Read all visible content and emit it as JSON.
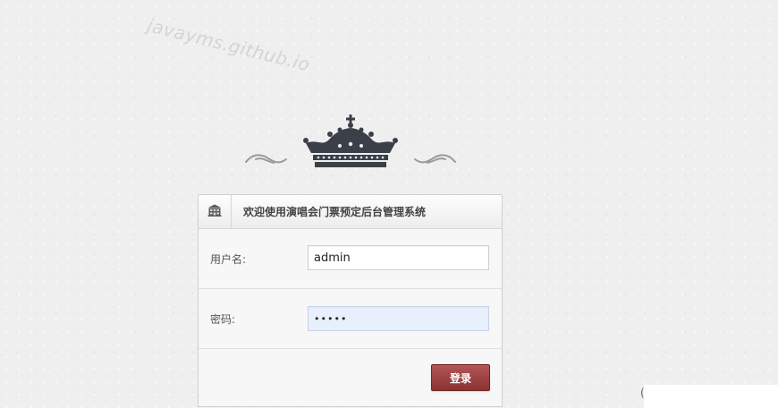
{
  "watermark": {
    "text": "javayms.github.io"
  },
  "decorations": {
    "crown_icon": "crown-icon",
    "left_flourish_icon": "flourish-left-icon",
    "right_flourish_icon": "flourish-right-icon",
    "crown_color": "#3b3f48",
    "flourish_color": "#9a9a9a"
  },
  "login_panel": {
    "header_icon": "building-icon",
    "title": "欢迎使用演唱会门票预定后台管理系统",
    "username": {
      "label": "用户名:",
      "value": "admin"
    },
    "password": {
      "label": "密码:",
      "value": "•••••"
    },
    "submit_label": "登录",
    "submit_color": "#9c3f3f"
  },
  "corner": {
    "mark": "("
  }
}
